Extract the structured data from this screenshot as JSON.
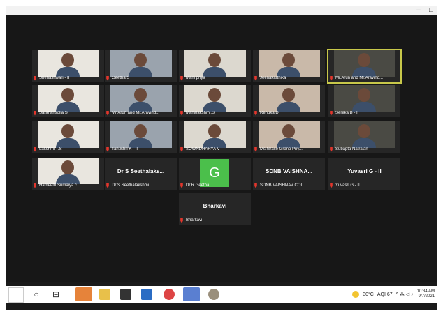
{
  "window": {
    "minimize": "–",
    "maximize": "□"
  },
  "tiles": [
    {
      "name": "Snehashwari - II",
      "type": "video"
    },
    {
      "name": "Geetha.S",
      "type": "video"
    },
    {
      "name": "Mani priya",
      "type": "video"
    },
    {
      "name": "Jeenakarthika",
      "type": "video"
    },
    {
      "name": "Mr.Arun and Mr.Aravind...",
      "type": "video",
      "selected": true
    },
    {
      "name": "Sarahansolla S",
      "type": "video"
    },
    {
      "name": "Mr.Arun and Mr.Aravind...",
      "type": "video"
    },
    {
      "name": "Mahalakshmi.S",
      "type": "video"
    },
    {
      "name": "Renuka D",
      "type": "video"
    },
    {
      "name": "Sereka B - II",
      "type": "video"
    },
    {
      "name": "Lakshmi T.S",
      "type": "video"
    },
    {
      "name": "Tanushri K - II",
      "type": "video"
    },
    {
      "name": "SOWNDHARYA V",
      "type": "video"
    },
    {
      "name": "Ms.Grace Grano Priy...",
      "type": "video"
    },
    {
      "name": "Subapta Natrajan",
      "type": "video"
    },
    {
      "name": "Hameeth Sumaiya c...",
      "type": "video"
    },
    {
      "name": "Dr S Seethalakshmi",
      "display": "Dr S Seethalaks...",
      "type": "text"
    },
    {
      "name": "Dr.R.Geetha",
      "initial": "G",
      "type": "avatar"
    },
    {
      "name": "SDNB VAISHNAV COL...",
      "display": "SDNB VAISHNA...",
      "type": "text"
    },
    {
      "name": "Yuvasri G - II",
      "display": "Yuvasri  G - II",
      "type": "text"
    },
    {
      "name": "Bharkavi",
      "display": "Bharkavi",
      "type": "text"
    }
  ],
  "taskbar": {
    "icons": [
      "start-icon",
      "search-icon",
      "task-view-icon",
      "edge-icon",
      "file-explorer-icon",
      "store-icon",
      "mail-icon",
      "chrome-icon",
      "zoom-icon",
      "paint-icon"
    ],
    "weather": "30°C",
    "aqi": "AQI 67",
    "time": "10:34 AM",
    "date": "9/7/2021",
    "tray_symbols": "^  ⁂  ◁  ♪"
  }
}
